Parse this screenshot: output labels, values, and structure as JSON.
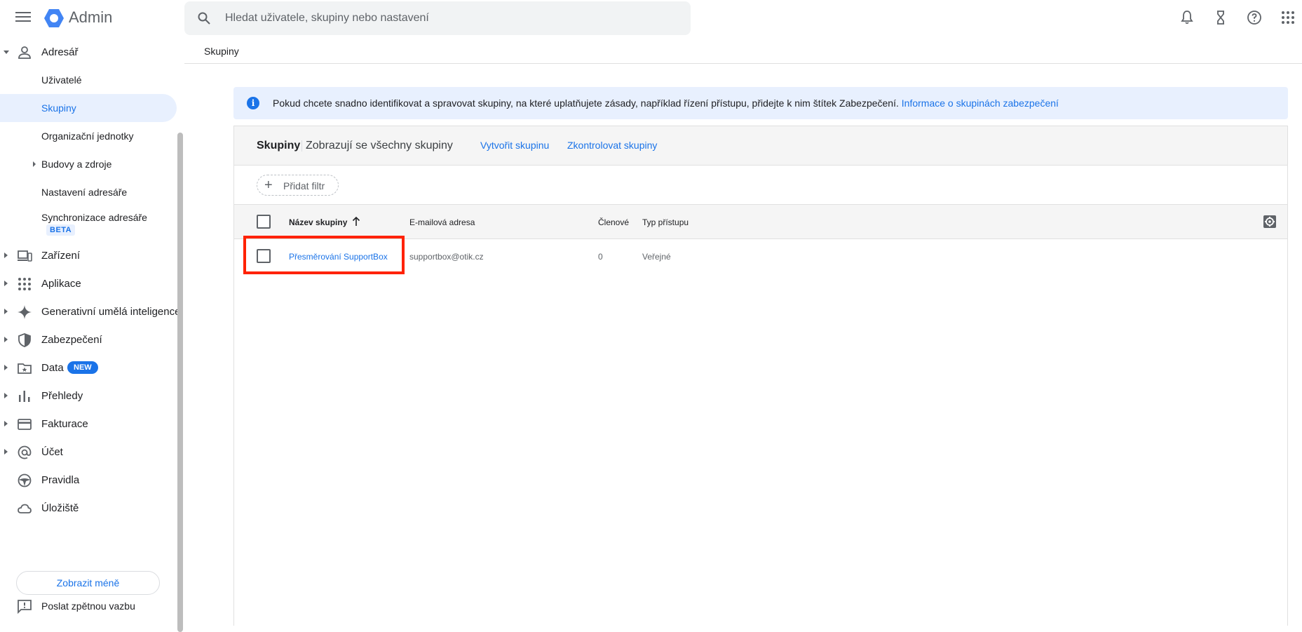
{
  "app": {
    "title": "Admin"
  },
  "search": {
    "placeholder": "Hledat uživatele, skupiny nebo nastavení"
  },
  "breadcrumb": {
    "current": "Skupiny"
  },
  "sidebar": {
    "adresar": "Adresář",
    "sub": {
      "users": "Uživatelé",
      "groups": "Skupiny",
      "org_units": "Organizační jednotky",
      "buildings": "Budovy a zdroje",
      "directory_settings": "Nastavení adresáře",
      "directory_sync": "Synchronizace adresáře",
      "beta": "BETA"
    },
    "items": {
      "devices": "Zařízení",
      "apps": "Aplikace",
      "gen_ai": "Generativní umělá inteligence",
      "security": "Zabezpečení",
      "data": "Data",
      "data_badge": "NEW",
      "reports": "Přehledy",
      "billing": "Fakturace",
      "account": "Účet",
      "rules": "Pravidla",
      "storage": "Úložiště"
    },
    "show_less": "Zobrazit méně",
    "feedback": "Poslat zpětnou vazbu"
  },
  "banner": {
    "text": "Pokud chcete snadno identifikovat a spravovat skupiny, na které uplatňujete zásady, například řízení přístupu, přidejte k nim štítek Zabezpečení. ",
    "link": "Informace o skupinách zabezpečení",
    "info_glyph": "i"
  },
  "panel": {
    "title": "Skupiny",
    "subtitle": "Zobrazují se všechny skupiny",
    "create": "Vytvořit skupinu",
    "review": "Zkontrolovat skupiny",
    "filter": "Přidat filtr"
  },
  "table": {
    "columns": {
      "name": "Název skupiny",
      "email": "E-mailová adresa",
      "members": "Členové",
      "access": "Typ přístupu"
    },
    "rows": [
      {
        "name": "Přesměrování SupportBox",
        "email": "supportbox@otik.cz",
        "members": "0",
        "access": "Veřejné"
      }
    ]
  },
  "colors": {
    "accent": "#1a73e8",
    "highlight": "#ff2200",
    "active_bg": "#e8f0fe"
  }
}
